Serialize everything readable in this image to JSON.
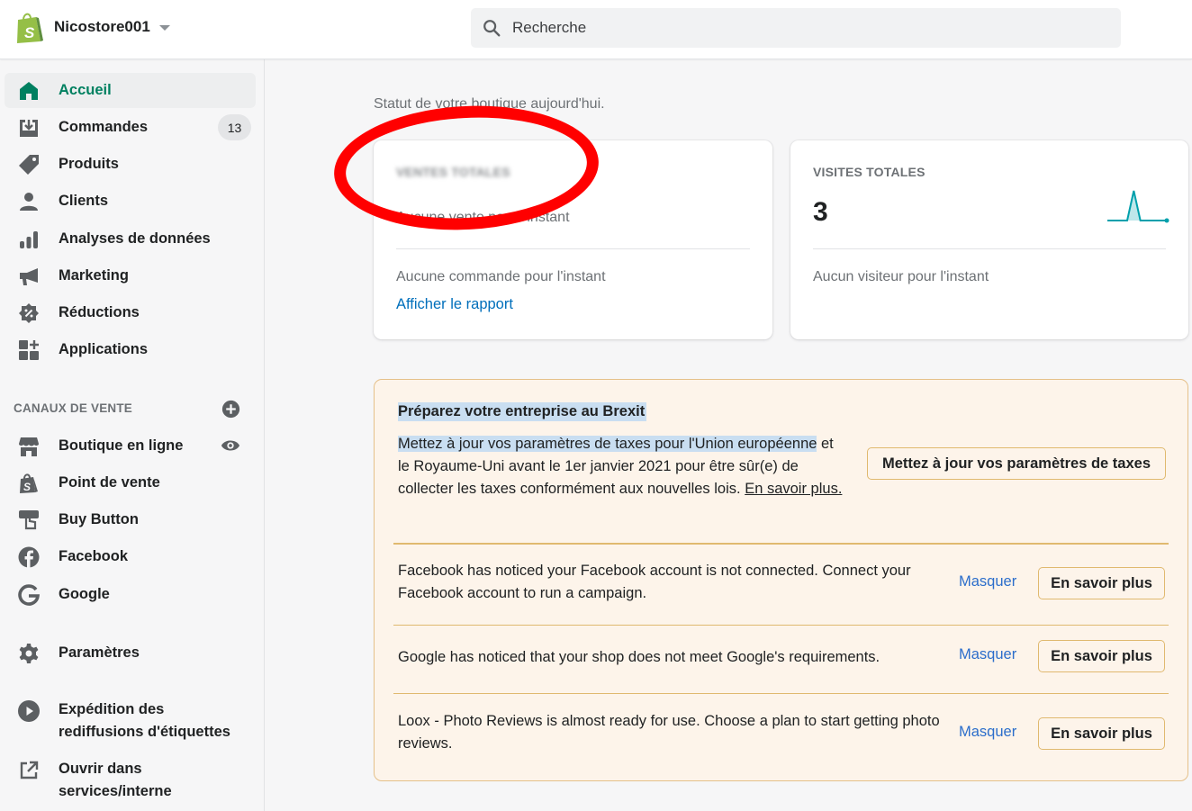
{
  "topbar": {
    "store_name": "Nicostore001",
    "search_placeholder": "Recherche"
  },
  "sidebar": {
    "items": [
      {
        "label": "Accueil",
        "icon": "home-icon",
        "active": true
      },
      {
        "label": "Commandes",
        "icon": "orders-icon",
        "badge": "13"
      },
      {
        "label": "Produits",
        "icon": "tag-icon"
      },
      {
        "label": "Clients",
        "icon": "person-icon"
      },
      {
        "label": "Analyses de données",
        "icon": "analytics-icon"
      },
      {
        "label": "Marketing",
        "icon": "megaphone-icon"
      },
      {
        "label": "Réductions",
        "icon": "discount-icon"
      },
      {
        "label": "Applications",
        "icon": "apps-icon"
      }
    ],
    "sales_channels_title": "CANAUX DE VENTE",
    "channels": [
      {
        "label": "Boutique en ligne",
        "icon": "store-icon"
      },
      {
        "label": "Point de vente",
        "icon": "shopify-bag-icon"
      },
      {
        "label": "Buy Button",
        "icon": "buy-button-icon"
      },
      {
        "label": "Facebook",
        "icon": "facebook-icon"
      },
      {
        "label": "Google",
        "icon": "google-icon"
      }
    ],
    "settings_label": "Paramètres",
    "extra": [
      {
        "label_line1": "Expédition des",
        "label_line2": "rediffusions d'étiquettes",
        "icon": "play-icon"
      },
      {
        "label_line1": "Ouvrir dans",
        "label_line2": "services/interne",
        "icon": "external-link-icon"
      }
    ]
  },
  "main": {
    "status_line": "Statut de votre boutique aujourd'hui.",
    "sales_card": {
      "heading": "VENTES TOTALES",
      "subtitle": "Aucune vente pour l'instant",
      "empty": "Aucune commande pour l'instant",
      "link": "Afficher le rapport"
    },
    "visits_card": {
      "heading": "VISITES TOTALES",
      "value": "3",
      "empty": "Aucun visiteur pour l'instant",
      "sparkline": [
        0,
        0,
        0,
        0,
        1,
        0,
        0,
        0,
        0,
        0
      ],
      "color": "#00a0ac"
    },
    "brexit": {
      "title": "Préparez votre entreprise au Brexit",
      "body_highlight": "Mettez à jour vos paramètres de taxes pour l'Union européenne",
      "body_rest": " et le Royaume-Uni avant le 1er janvier 2021 pour être sûr(e) de collecter les taxes conformément aux nouvelles lois. ",
      "learn_more": "En savoir plus.",
      "button": "Mettez à jour vos paramètres de taxes"
    },
    "notices": [
      {
        "text": "Facebook has noticed your Facebook account is not connected. Connect your Facebook account to run a campaign.",
        "dismiss": "Masquer",
        "action": "En savoir plus"
      },
      {
        "text": "Google has noticed that your shop does not meet Google's requirements.",
        "dismiss": "Masquer",
        "action": "En savoir plus"
      },
      {
        "text": "Loox - Photo Reviews is almost ready for use. Choose a plan to start getting photo reviews.",
        "dismiss": "Masquer",
        "action": "En savoir plus"
      }
    ]
  },
  "colors": {
    "accent_green": "#008060",
    "link_blue": "#006fbb",
    "notice_bg": "#fdf4ea",
    "notice_border": "#e0b96f",
    "annotation_red": "#ff0000"
  }
}
